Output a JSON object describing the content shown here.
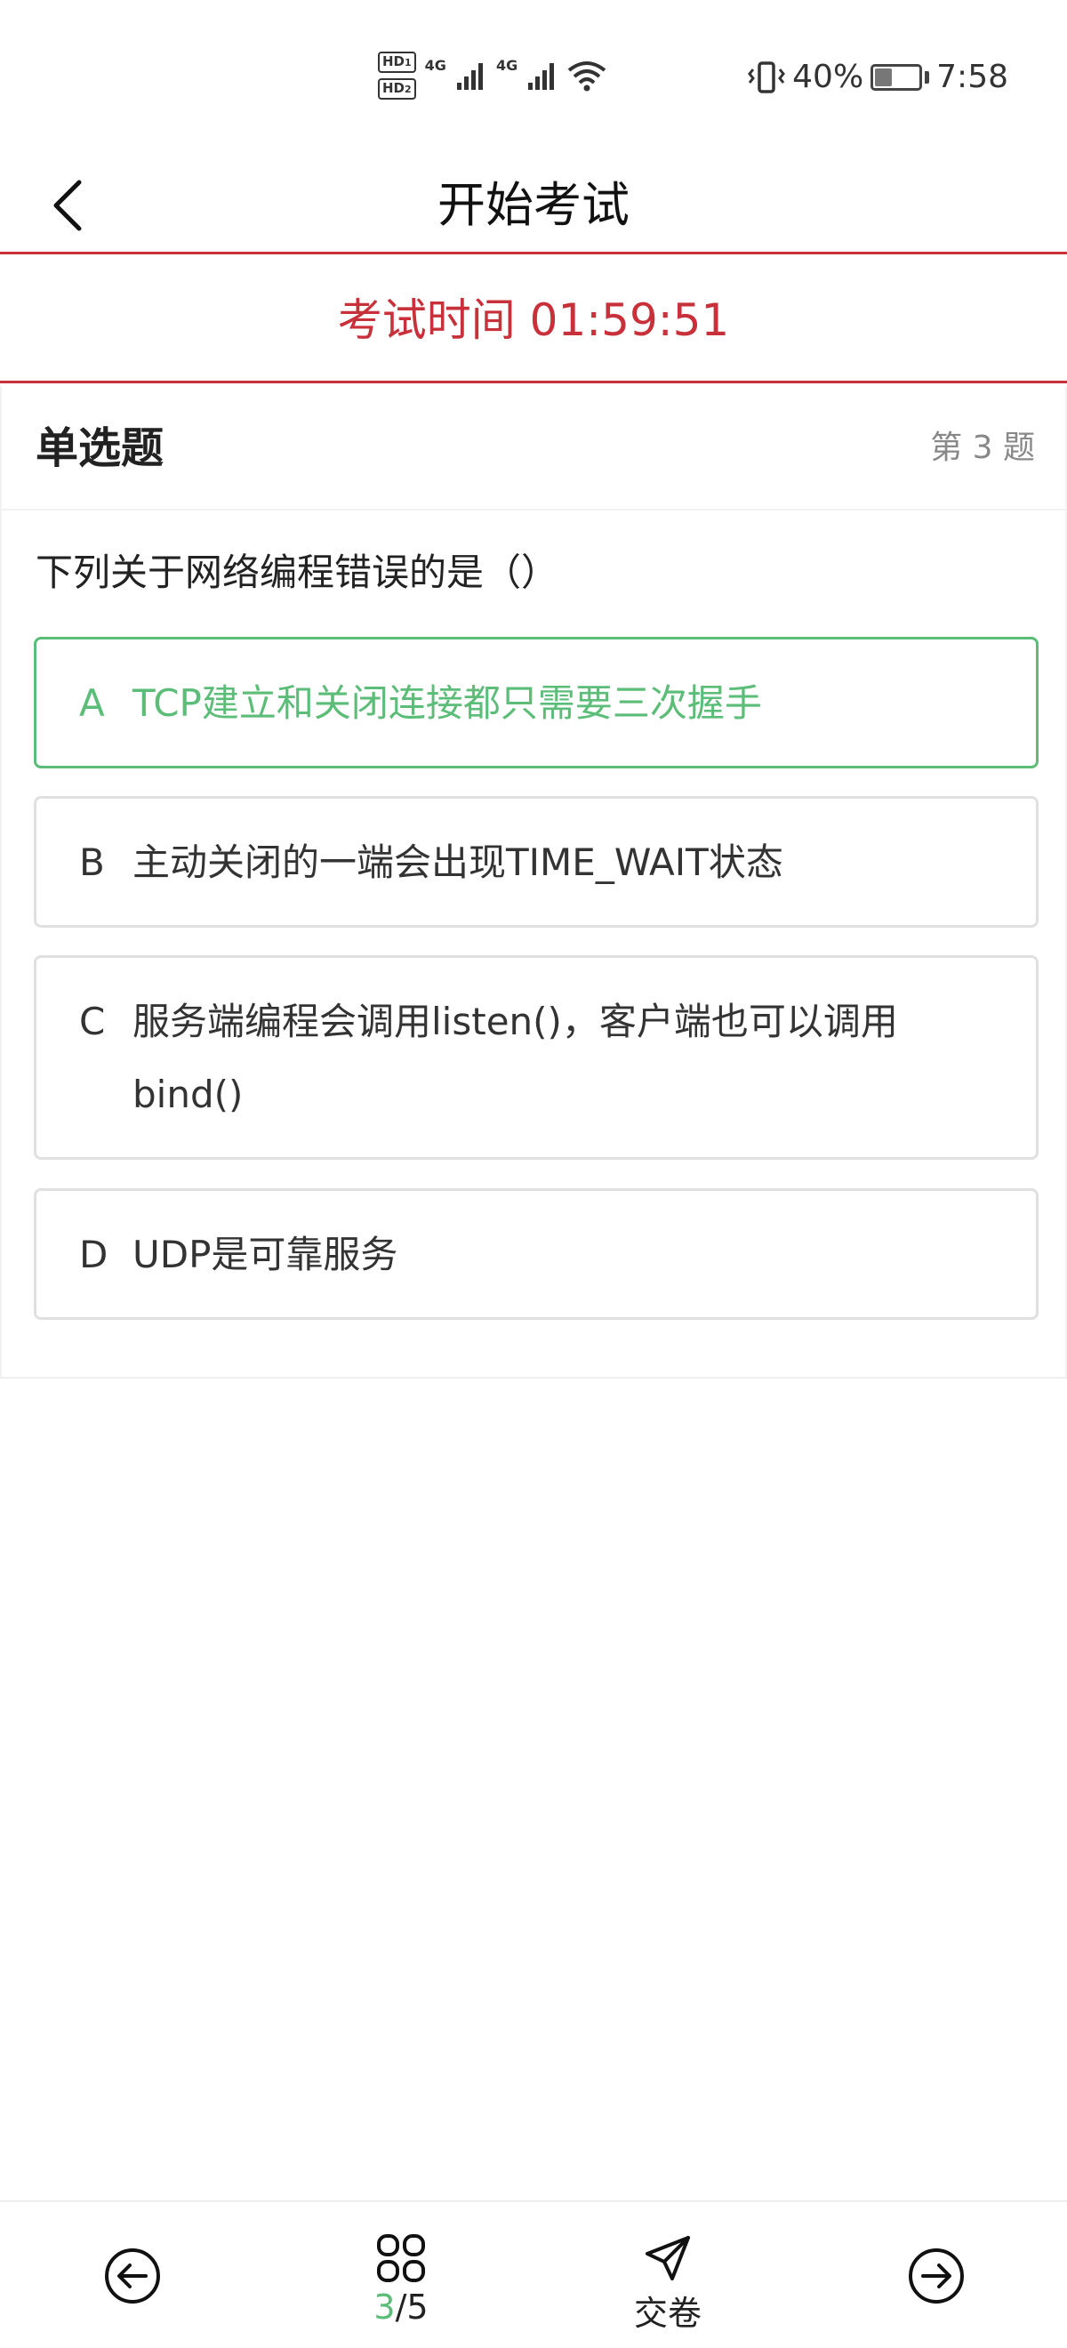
{
  "status_bar": {
    "sim1": "HD",
    "sim1_index": "1",
    "sim2": "HD",
    "sim2_index": "2",
    "net1": "4G",
    "net2": "4G",
    "battery": "40%",
    "battery_level": 0.4,
    "time": "7:58"
  },
  "header": {
    "title": "开始考试"
  },
  "timer": {
    "text": "考试时间 01:59:51"
  },
  "question": {
    "type": "单选题",
    "number_label": "第 3 题",
    "text": "下列关于网络编程错误的是（）",
    "options": [
      {
        "letter": "A",
        "text": "TCP建立和关闭连接都只需要三次握手",
        "selected": true
      },
      {
        "letter": "B",
        "text": "主动关闭的一端会出现TIME_WAIT状态",
        "selected": false
      },
      {
        "letter": "C",
        "text": "服务端编程会调用listen()，客户端也可以调用bind()",
        "selected": false
      },
      {
        "letter": "D",
        "text": "UDP是可靠服务",
        "selected": false
      }
    ]
  },
  "bottom_nav": {
    "progress_current": "3",
    "progress_total": "/5",
    "submit_label": "交卷"
  },
  "colors": {
    "accent_red": "#c8303a",
    "selected_green": "#5bbd77"
  }
}
